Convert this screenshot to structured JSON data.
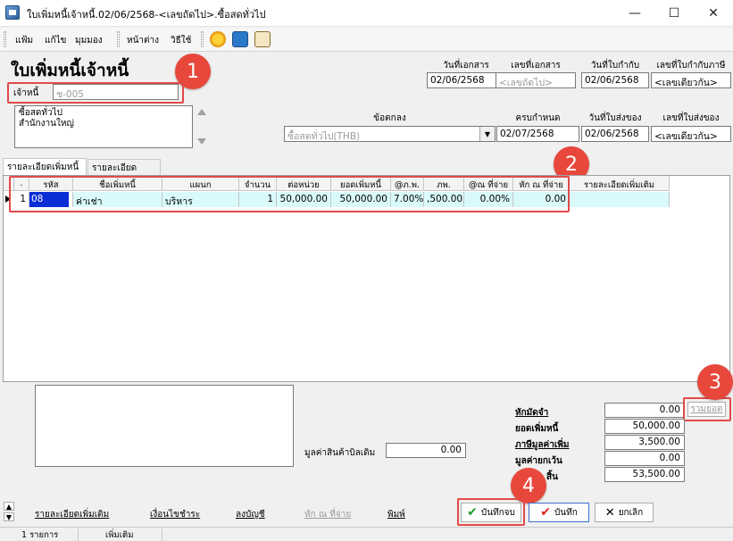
{
  "window": {
    "title": "ใบเพิ่มหนี้เจ้าหนี้.02/06/2568-<เลขถัดไป>.ซื้อสดทั่วไป",
    "minimize": "—",
    "maximize": "☐",
    "close": "✕"
  },
  "menu": {
    "items": [
      "แฟ้ม",
      "แก้ไข",
      "มุมมอง",
      "หน้าต่าง",
      "วิธีใช้"
    ]
  },
  "form": {
    "title": "ใบเพิ่มหนี้เจ้าหนี้",
    "creditor_label": "เจ้าหนี้",
    "creditor_value": "ช-005",
    "address_line1": "ซื้อสดทั่วไป",
    "address_line2": "สำนักงานใหญ่",
    "doc_date_label": "วันที่เอกสาร",
    "doc_date": "02/06/2568",
    "doc_no_label": "เลขที่เอกสาร",
    "doc_no": "<เลขถัดไป>",
    "invoice_date_label": "วันที่ใบกำกับ",
    "invoice_date": "02/06/2568",
    "tax_invoice_no_label": "เลขที่ใบกำกับภาษี",
    "tax_invoice_no": "<เลขเดียวกัน>",
    "agreement_label": "ข้อตกลง",
    "agreement": "ซื้อสดทั่วไป(THB)",
    "due_label": "ครบกำหนด",
    "due_date": "02/07/2568",
    "delivery_date_label": "วันที่ใบส่งของ",
    "delivery_date": "02/06/2568",
    "delivery_no_label": "เลขที่ใบส่งของ",
    "delivery_no": "<เลขเดียวกัน>"
  },
  "tabs": [
    "รายละเอียดเพิ่มหนี้",
    "รายละเอียดชำระ"
  ],
  "grid": {
    "headers": [
      ".",
      "รหัส",
      "ชื่อเพิ่มหนี้",
      "แผนก",
      "จำนวน",
      "ต่อหน่วย",
      "ยอดเพิ่มหนี้",
      "@ภ.พ.",
      "ภพ.",
      "@ณ ที่จ่าย",
      "หัก ณ ที่จ่าย",
      "รายละเอียดเพิ่มเติม"
    ],
    "rows": [
      [
        "1",
        "08",
        "ค่าเช่า",
        "บริหาร",
        "1",
        "50,000.00",
        "50,000.00",
        "7.00%",
        ",500.00",
        "0.00%",
        "0.00"
      ]
    ]
  },
  "summary": {
    "original_value_label": "มูลค่าสินค้าบิลเดิม",
    "original_value": "0.00",
    "deposit_label": "หักมัดจำ",
    "deposit": "0.00",
    "total_button": "รวมยอด",
    "debit_amount_label": "ยอดเพิ่มหนี้",
    "debit_amount": "50,000.00",
    "vat_label": "ภาษีมูลค่าเพิ่ม",
    "vat": "3,500.00",
    "exempt_label": "มูลค่ายกเว้น",
    "exempt": "0.00",
    "net_label": "สิ้น",
    "net": "53,500.00"
  },
  "footer": {
    "links": [
      "รายละเอียดเพิ่มเติม",
      "เงื่อนไขชำระ",
      "ลงบัญชี",
      "หัก ณ ที่จ่าย",
      "พิมพ์"
    ],
    "save_close": "บันทึกจบ",
    "save": "บันทึก",
    "cancel": "ยกเลิก"
  },
  "status": {
    "count": "1 รายการ",
    "mode": "เพิ่มเติม"
  },
  "callouts": [
    "1",
    "2",
    "3",
    "4"
  ],
  "colors": {
    "callout": "#e8473c",
    "row_highlight": "#d9f9fb",
    "selected_cell": "#0a2dd6"
  }
}
